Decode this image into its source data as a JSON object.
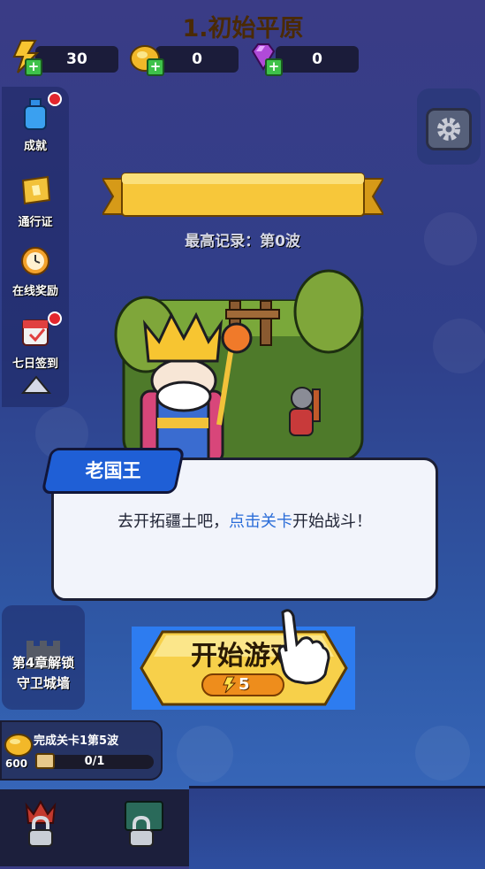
{
  "resources": [
    {
      "icon": "energy-icon",
      "value": "30"
    },
    {
      "icon": "gold-coin-icon",
      "value": "0"
    },
    {
      "icon": "gem-icon",
      "value": "0"
    }
  ],
  "left_menu": [
    {
      "label": "成就",
      "icon": "achievement-potion-icon",
      "badge": true
    },
    {
      "label": "通行证",
      "icon": "pass-ticket-icon",
      "badge": false
    },
    {
      "label": "在线奖励",
      "icon": "online-reward-clock-icon",
      "badge": false
    },
    {
      "label": "七日签到",
      "icon": "seven-day-calendar-icon",
      "badge": true
    }
  ],
  "level": {
    "title": "1.初始平原",
    "best_record": "最高记录：第0波"
  },
  "dialog": {
    "speaker": "老国王",
    "text_before": "去开拓疆土吧，",
    "text_highlight": "点击关卡",
    "text_after": "开始战斗！"
  },
  "start_button": {
    "label": "开始游戏",
    "cost": "5"
  },
  "chapter_unlock": {
    "line1": "第4章解锁",
    "line2": "守卫城墙"
  },
  "quest": {
    "title": "完成关卡1第5波",
    "progress": "0/1",
    "reward": "600"
  },
  "colors": {
    "accent_blue": "#1f5fd6",
    "highlight_text": "#2a6cd8",
    "gold_button": "#f7d04a",
    "energy_badge": "#ee8d1c"
  }
}
